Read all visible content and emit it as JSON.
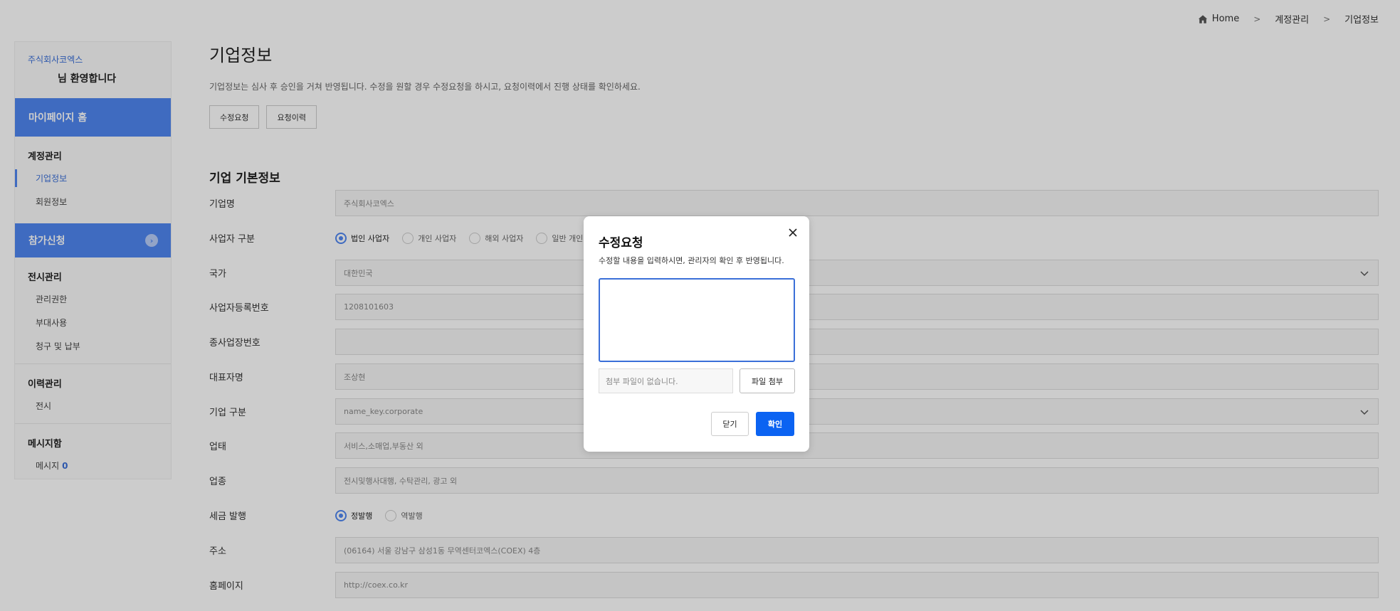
{
  "breadcrumb": {
    "home": "Home",
    "level1": "계정관리",
    "level2": "기업정보"
  },
  "sidebar": {
    "company": "주식회사코엑스",
    "welcome": "님 환영합니다",
    "mypage_home": "마이페이지 홈",
    "account_group": "계정관리",
    "account_items": [
      "기업정보",
      "회원정보"
    ],
    "apply": "참가신청",
    "exhibit_group": "전시관리",
    "exhibit_items": [
      "관리권한",
      "부대사용",
      "청구 및 납부"
    ],
    "history_group": "이력관리",
    "history_items": [
      "전시"
    ],
    "message_group": "메시지함",
    "message_label": "메시지",
    "message_count": "0"
  },
  "main": {
    "title": "기업정보",
    "description": "기업정보는 심사 후 승인을 거쳐 반영됩니다. 수정을 원할 경우 수정요청을 하시고, 요청이력에서 진행 상태를 확인하세요.",
    "edit_request_btn": "수정요청",
    "request_history_btn": "요청이력",
    "section_title": "기업 기본정보",
    "fields": {
      "company_name": {
        "label": "기업명",
        "value": "주식회사코엑스"
      },
      "business_type": {
        "label": "사업자 구분",
        "options": [
          "법인 사업자",
          "개인 사업자",
          "해외 사업자",
          "일반 개인"
        ],
        "selected": "법인 사업자"
      },
      "country": {
        "label": "국가",
        "value": "대한민국"
      },
      "reg_number": {
        "label": "사업자등록번호",
        "value": "1208101603"
      },
      "branch_number": {
        "label": "종사업장번호",
        "value": ""
      },
      "ceo": {
        "label": "대표자명",
        "value": "조상현"
      },
      "company_type": {
        "label": "기업 구분",
        "value": "name_key.corporate"
      },
      "industry": {
        "label": "업태",
        "value": "서비스,소매업,부동산 외"
      },
      "category": {
        "label": "업종",
        "value": "전시및행사대행, 수탁관리, 광고 외"
      },
      "tax_invoice": {
        "label": "세금 발행",
        "options": [
          "정발행",
          "역발행"
        ],
        "selected": "정발행"
      },
      "address": {
        "label": "주소",
        "value": "(06164)  서울 강남구 삼성1동 무역센터코엑스(COEX)  4층"
      },
      "homepage": {
        "label": "홈페이지",
        "value": "http://coex.co.kr"
      }
    }
  },
  "modal": {
    "title": "수정요청",
    "description": "수정할 내용을 입력하시면, 관리자의 확인 후 반영됩니다.",
    "textarea_value": "",
    "file_placeholder": "첨부 파일이 없습니다.",
    "file_button": "파일 첨부",
    "cancel_button": "닫기",
    "confirm_button": "확인"
  },
  "colors": {
    "accent": "#4f86f0",
    "confirm": "#0b63f2",
    "link": "#3a6fd8"
  }
}
